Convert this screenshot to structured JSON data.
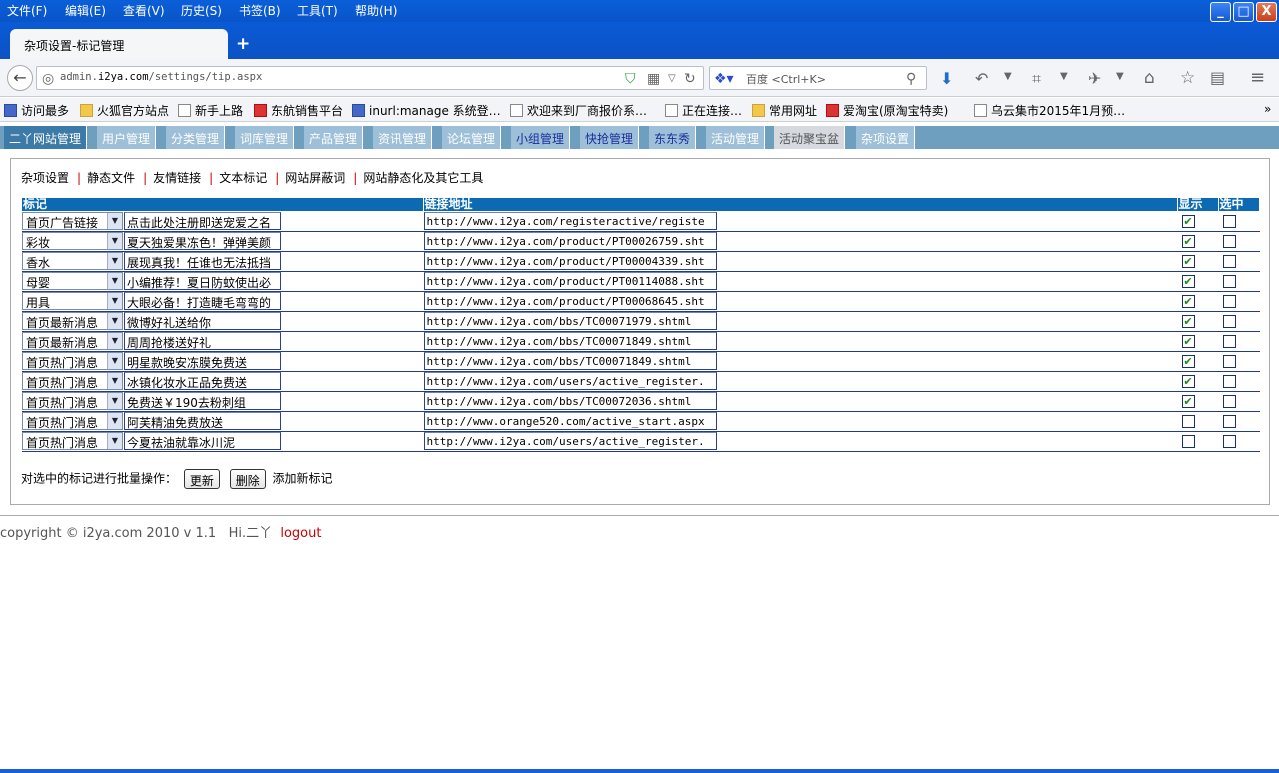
{
  "menubar": {
    "items": [
      "文件(F)",
      "编辑(E)",
      "查看(V)",
      "历史(S)",
      "书签(B)",
      "工具(T)",
      "帮助(H)"
    ]
  },
  "window_buttons": {
    "minimize": "_",
    "maximize": "□",
    "close": "X"
  },
  "tab": {
    "title": "杂项设置-标记管理",
    "new_tab": "+"
  },
  "address": {
    "url_prefix": "admin.",
    "url_domain": "i2ya.com",
    "url_path": "/settings/tip.aspx"
  },
  "search": {
    "engine": "百度",
    "placeholder": "百度 <Ctrl+K>"
  },
  "bookmarks": [
    {
      "label": "访问最多",
      "icon": "blue"
    },
    {
      "label": "火狐官方站点",
      "icon": "fold"
    },
    {
      "label": "新手上路",
      "icon": "page"
    },
    {
      "label": "东航销售平台",
      "icon": "red"
    },
    {
      "label": "inurl:manage 系统登…",
      "icon": "blue"
    },
    {
      "label": "欢迎来到厂商报价系…",
      "icon": "page"
    },
    {
      "label": "正在连接…",
      "icon": "page"
    },
    {
      "label": "常用网址",
      "icon": "fold"
    },
    {
      "label": "爱淘宝(原淘宝特卖)",
      "icon": "red"
    },
    {
      "label": "乌云集市2015年1月预…",
      "icon": "page"
    }
  ],
  "bookmarks_more": "»",
  "site_nav": [
    {
      "label": "二丫网站管理",
      "style": "first"
    },
    {
      "label": "用户管理",
      "style": ""
    },
    {
      "label": "分类管理",
      "style": ""
    },
    {
      "label": "词库管理",
      "style": ""
    },
    {
      "label": "产品管理",
      "style": ""
    },
    {
      "label": "资讯管理",
      "style": ""
    },
    {
      "label": "论坛管理",
      "style": ""
    },
    {
      "label": "小组管理",
      "style": "hl"
    },
    {
      "label": "快抢管理",
      "style": "hl"
    },
    {
      "label": "东东秀",
      "style": "hl"
    },
    {
      "label": "活动管理",
      "style": ""
    },
    {
      "label": "活动聚宝盆",
      "style": "active"
    },
    {
      "label": "杂项设置",
      "style": ""
    }
  ],
  "sub_links": [
    "杂项设置",
    "静态文件",
    "友情链接",
    "文本标记",
    "网站屏蔽词",
    "网站静态化及其它工具"
  ],
  "table": {
    "headers": {
      "tag": "标记",
      "link": "链接地址",
      "show": "显示",
      "select": "选中"
    },
    "rows": [
      {
        "tag": "首页广告链接",
        "text": "点击此处注册即送宠爱之名",
        "link": "http://www.i2ya.com/registeractive/registe",
        "show": true,
        "selected": false
      },
      {
        "tag": "彩妆",
        "text": "夏天独爱果冻色！弹弹美颜",
        "link": "http://www.i2ya.com/product/PT00026759.sht",
        "show": true,
        "selected": false
      },
      {
        "tag": "香水",
        "text": "展现真我！任谁也无法抵挡",
        "link": "http://www.i2ya.com/product/PT00004339.sht",
        "show": true,
        "selected": false
      },
      {
        "tag": "母婴",
        "text": "小编推荐！夏日防蚊使出必",
        "link": "http://www.i2ya.com/product/PT00114088.sht",
        "show": true,
        "selected": false
      },
      {
        "tag": "用具",
        "text": "大眼必备！打造睫毛弯弯的",
        "link": "http://www.i2ya.com/product/PT00068645.sht",
        "show": true,
        "selected": false
      },
      {
        "tag": "首页最新消息",
        "text": "微博好礼送给你",
        "link": "http://www.i2ya.com/bbs/TC00071979.shtml",
        "show": true,
        "selected": false
      },
      {
        "tag": "首页最新消息",
        "text": "周周抢楼送好礼",
        "link": "http://www.i2ya.com/bbs/TC00071849.shtml",
        "show": true,
        "selected": false
      },
      {
        "tag": "首页热门消息",
        "text": "明星款晚安冻膜免费送",
        "link": "http://www.i2ya.com/bbs/TC00071849.shtml",
        "show": true,
        "selected": false
      },
      {
        "tag": "首页热门消息",
        "text": "冰镇化妆水正品免费送",
        "link": "http://www.i2ya.com/users/active_register.",
        "show": true,
        "selected": false
      },
      {
        "tag": "首页热门消息",
        "text": "免费送￥190去粉刺组",
        "link": "http://www.i2ya.com/bbs/TC00072036.shtml",
        "show": true,
        "selected": false
      },
      {
        "tag": "首页热门消息",
        "text": "阿芙精油免费放送",
        "link": "http://www.orange520.com/active_start.aspx",
        "show": false,
        "selected": false
      },
      {
        "tag": "首页热门消息",
        "text": "今夏祛油就靠冰川泥",
        "link": "http://www.i2ya.com/users/active_register.",
        "show": false,
        "selected": false
      }
    ]
  },
  "batch": {
    "label": "对选中的标记进行批量操作：",
    "update": "更新",
    "delete": "删除",
    "add": "添加新标记"
  },
  "footer": {
    "copyright": "copyright © i2ya.com 2010 v 1.1",
    "greeting": "Hi.二丫",
    "logout": "logout"
  }
}
